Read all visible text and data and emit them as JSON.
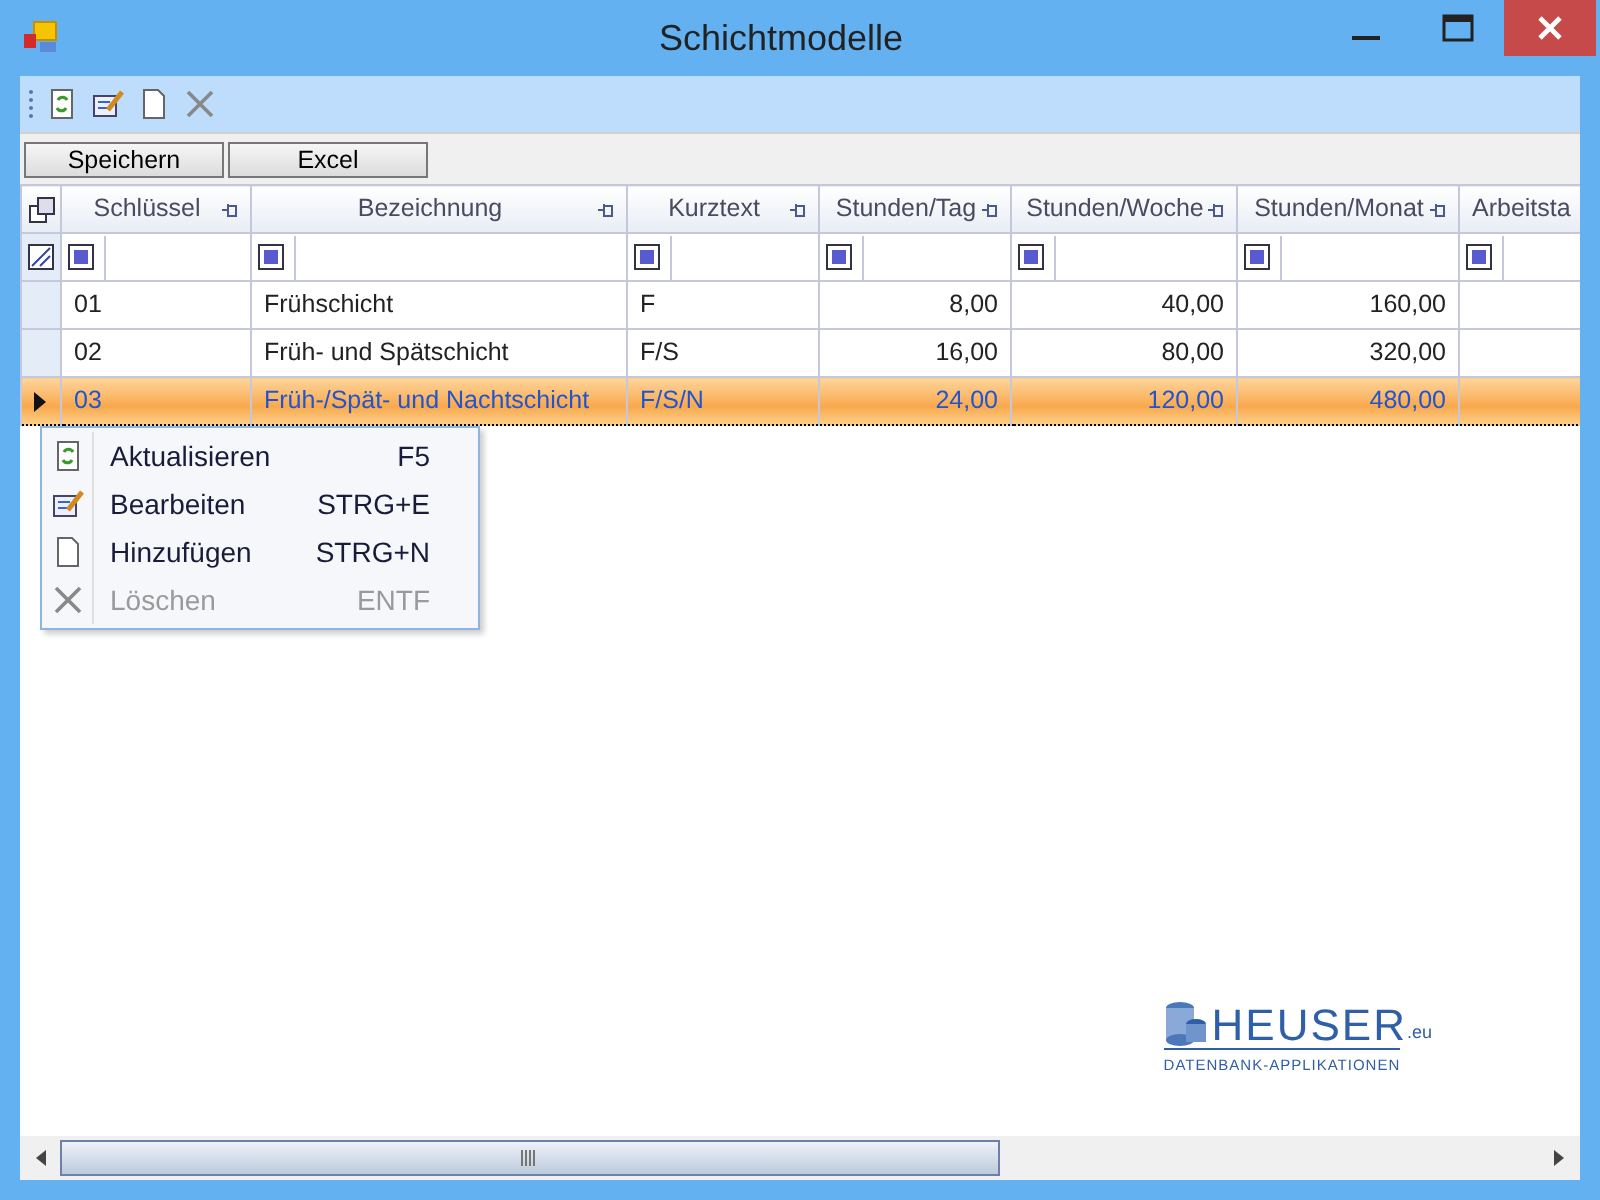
{
  "window": {
    "title": "Schichtmodelle"
  },
  "buttons": [
    "Speichern",
    "Excel"
  ],
  "table": {
    "columns": [
      {
        "label": "Schlüssel",
        "kind": "text"
      },
      {
        "label": "Bezeichnung",
        "kind": "text"
      },
      {
        "label": "Kurztext",
        "kind": "text"
      },
      {
        "label": "Stunden/Tag",
        "kind": "number"
      },
      {
        "label": "Stunden/Woche",
        "kind": "number"
      },
      {
        "label": "Stunden/Monat",
        "kind": "number"
      },
      {
        "label": "Arbeitsta",
        "kind": "text"
      }
    ],
    "rows": [
      {
        "cells": [
          "01",
          "Frühschicht",
          "F",
          "8,00",
          "40,00",
          "160,00"
        ],
        "selected": false
      },
      {
        "cells": [
          "02",
          "Früh- und Spätschicht",
          "F/S",
          "16,00",
          "80,00",
          "320,00"
        ],
        "selected": false
      },
      {
        "cells": [
          "03",
          "Früh-/Spät- und Nachtschicht",
          "F/S/N",
          "24,00",
          "120,00",
          "480,00"
        ],
        "selected": true
      }
    ]
  },
  "context_menu": {
    "items": [
      {
        "kind": "refresh",
        "label": "Aktualisieren",
        "shortcut": "F5",
        "disabled": false
      },
      {
        "kind": "edit",
        "label": "Bearbeiten",
        "shortcut": "STRG+E",
        "disabled": false
      },
      {
        "kind": "add",
        "label": "Hinzufügen",
        "shortcut": "STRG+N",
        "disabled": false
      },
      {
        "kind": "delete",
        "label": "Löschen",
        "shortcut": "ENTF",
        "disabled": true
      }
    ]
  },
  "logo": {
    "name": "HEUSER",
    "suffix": ".eu",
    "tagline": "DATENBANK-APPLIKATIONEN"
  }
}
